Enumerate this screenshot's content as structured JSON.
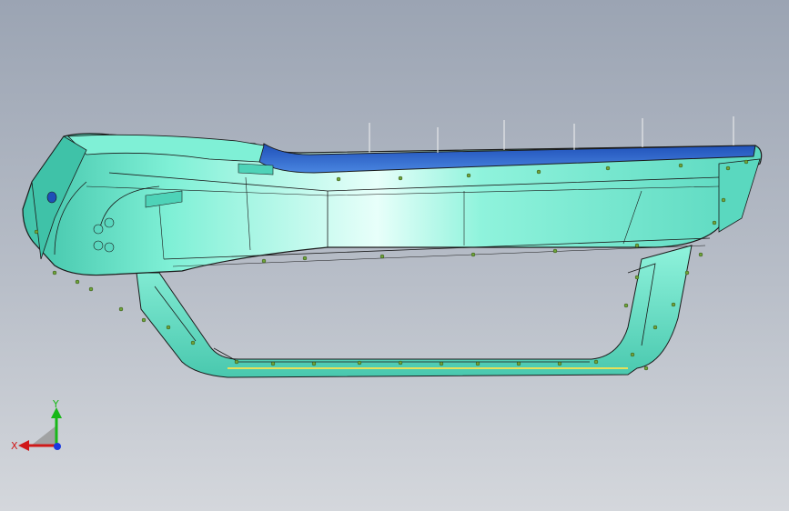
{
  "viewport": {
    "background_top": "#9ba4b3",
    "background_bottom": "#d4d7dc",
    "model": {
      "name": "bumper-part",
      "colors": {
        "face": "#7ff0d6",
        "face_highlight": "#d8fff4",
        "face_shade": "#3fc2a8",
        "top_flange": "#2f64c8",
        "edge": "#1a1a1a",
        "hole_marker": "#6fa43a",
        "yellow_strip": "#e7e05a"
      },
      "annotation_count": 6
    }
  },
  "triad": {
    "x_label": "X",
    "y_label": "Y",
    "x_color": "#d01818",
    "y_color": "#18b818",
    "z_color": "#1838e0",
    "plane_color": "#9a9a9a"
  }
}
